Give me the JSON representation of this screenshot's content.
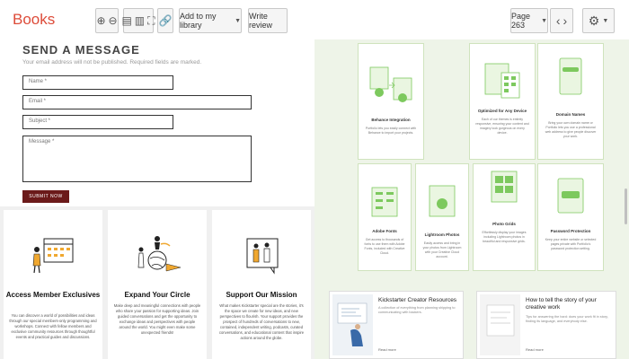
{
  "toolbar": {
    "brand": "Books",
    "zoom_in_icon": "zoom-in-icon",
    "zoom_out_icon": "zoom-out-icon",
    "add_library_label": "Add to my library",
    "write_review_label": "Write review",
    "page_label": "Page 263",
    "colors": {
      "brand": "#dd4b39"
    }
  },
  "left_page": {
    "form": {
      "title": "SEND A MESSAGE",
      "subtitle": "Your email address will not be published. Required fields are marked.",
      "name_placeholder": "Name *",
      "email_placeholder": "Email *",
      "subject_placeholder": "Subject *",
      "message_placeholder": "Message *",
      "submit_label": "SUBMIT NOW"
    },
    "cards": [
      {
        "title": "Access Member Exclusives",
        "desc": "You can discover a world of possibilities and ideas through our special members-only programming and workshops. Connect with fellow members and exclusive community resources through thoughtful events and practical guides and discussions."
      },
      {
        "title": "Expand Your Circle",
        "desc": "Make deep and meaningful connections with people who share your passion for supporting ideas. Join guided conversations and get the opportunity to exchange ideas and perspectives with people around the world. You might even make some unexpected friends!"
      },
      {
        "title": "Support Our Mission",
        "desc": "What makes Kickstarter special are the stories, it's the space we create for new ideas, and new perspectives to flourish. Your support provides the prospect of hundreds of conversations to new, contained, independent writing, podcasts, curated conversations, and educational content that inspire actions around the globe."
      }
    ]
  },
  "right_page": {
    "tiles_top": [
      {
        "title": "Behance Integration",
        "desc": "Portfolio lets you easily connect with Behance to import your projects."
      },
      {
        "title": "Optimized for Any Device",
        "desc": "Each of our themes is entirely responsive, ensuring your content and imagery look gorgeous on every device."
      },
      {
        "title": "Domain Names",
        "desc": "Bring your own domain name or Portfolio lets you use a professional web address to give people discover your work."
      }
    ],
    "tiles_bottom": [
      {
        "title": "Adobe Fonts",
        "desc": "Get access to thousands of fonts to use them with Adobe Fonts, included with Creative Cloud."
      },
      {
        "title": "Lightroom Photos",
        "desc": "Easily access and bring in your photos from Lightroom with your Creative Cloud account."
      },
      {
        "title": "Photo Grids",
        "desc": "Effortlessly display your images including Lightroom photos in beautiful and responsive grids."
      },
      {
        "title": "Password Protection",
        "desc": "Keep your entire website or selected pages private with Portfolio's password protection setting."
      }
    ],
    "articles": [
      {
        "title": "Kickstarter Creator Resources",
        "desc": "A collection of everything from planning shipping to communicating with backers.",
        "more": "Read more"
      },
      {
        "title": "How to tell the story of your creative work",
        "desc": "Tips for answering the hard: does your work fit in story, finding its language, and everybody else.",
        "more": "Read more"
      }
    ],
    "colors": {
      "accent": "#7dc95e",
      "tile_border": "#cfe3bd",
      "bg": "#eef4e8"
    }
  }
}
